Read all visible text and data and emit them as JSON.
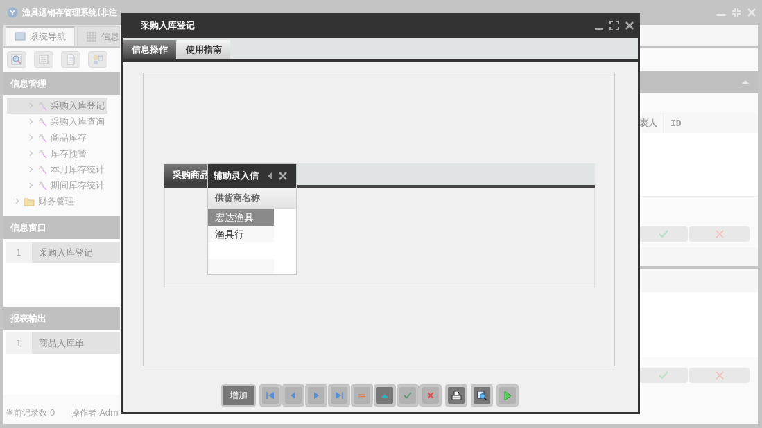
{
  "app": {
    "title": "渔具进销存管理系统(非注"
  },
  "tabs": [
    {
      "label": "系统导航",
      "kind": "nav",
      "selected": true
    },
    {
      "label": "信息",
      "kind": "grid",
      "selected": false
    }
  ],
  "sidebar": {
    "title": "信息管理",
    "items": [
      {
        "label": "采购入库登记",
        "kind": "leaf",
        "selected": true
      },
      {
        "label": "采购入库查询",
        "kind": "leaf",
        "selected": false
      },
      {
        "label": "商品库存",
        "kind": "leaf",
        "selected": false
      },
      {
        "label": "库存预警",
        "kind": "leaf",
        "selected": false
      },
      {
        "label": "本月库存统计",
        "kind": "leaf",
        "selected": false
      },
      {
        "label": "期间库存统计",
        "kind": "leaf",
        "selected": false
      },
      {
        "label": "财务管理",
        "kind": "folder",
        "selected": false,
        "expanded": false
      }
    ]
  },
  "window_list": {
    "title": "信息窗口",
    "rows": [
      {
        "index": "1",
        "label": "采购入库登记"
      }
    ]
  },
  "report_list": {
    "title": "报表输出",
    "rows": [
      {
        "index": "1",
        "label": "商品入库单"
      }
    ]
  },
  "status_bar": [
    "当前记录数 0",
    "操作者:Adm"
  ],
  "right_panel": {
    "columns": [
      "表人",
      "ID"
    ]
  },
  "dialog": {
    "title": "采购入库登记",
    "tabs": [
      {
        "label": "信息操作",
        "selected": true
      },
      {
        "label": "使用指南",
        "selected": false
      }
    ],
    "panel": {
      "tab": "采购商品"
    },
    "lookup": {
      "title": "辅助录入信",
      "column": "供货商名称",
      "rows": [
        {
          "name": "宏达渔具",
          "selected": true
        },
        {
          "name": "渔具行",
          "selected": false
        }
      ]
    },
    "toolbar": [
      {
        "kind": "text",
        "label": "增加",
        "highlighted": true
      },
      {
        "kind": "first",
        "highlighted": false
      },
      {
        "kind": "prev",
        "highlighted": false
      },
      {
        "kind": "next",
        "highlighted": false
      },
      {
        "kind": "last",
        "highlighted": false
      },
      {
        "kind": "delete",
        "highlighted": false
      },
      {
        "kind": "up",
        "highlighted": true
      },
      {
        "kind": "confirm",
        "highlighted": false
      },
      {
        "kind": "cancel",
        "highlighted": false
      },
      {
        "kind": "print",
        "highlighted": true
      },
      {
        "kind": "preview",
        "highlighted": true
      },
      {
        "kind": "run",
        "highlighted": false
      }
    ]
  }
}
